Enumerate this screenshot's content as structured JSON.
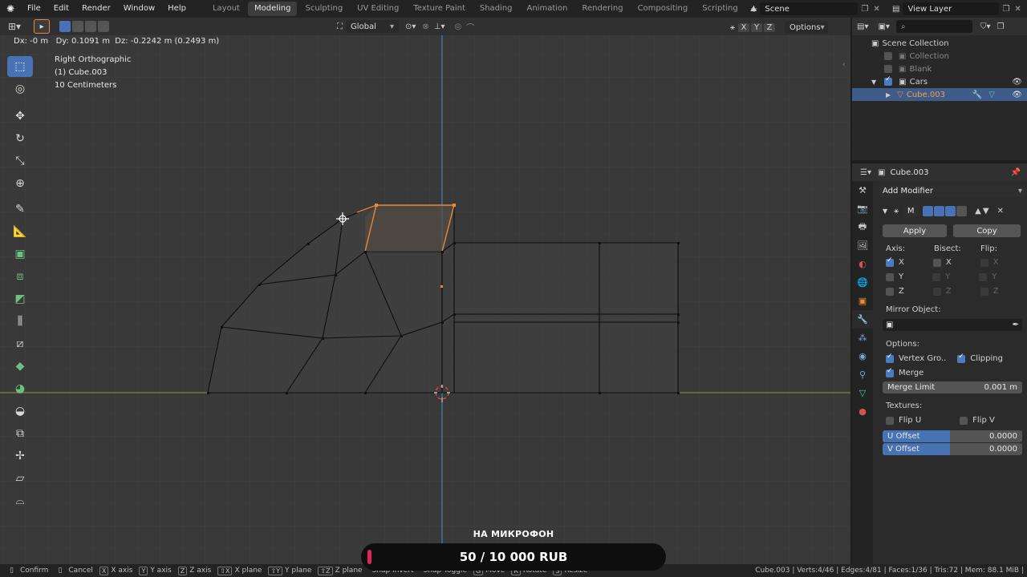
{
  "topbar": {
    "menus": [
      "File",
      "Edit",
      "Render",
      "Window",
      "Help"
    ],
    "workspaces": [
      "Layout",
      "Modeling",
      "Sculpting",
      "UV Editing",
      "Texture Paint",
      "Shading",
      "Animation",
      "Rendering",
      "Compositing",
      "Scripting"
    ],
    "active_workspace": "Modeling",
    "scene": "Scene",
    "view_layer": "View Layer"
  },
  "viewport": {
    "transform_readout": "Dx: -0 m   Dy: 0.1091 m  Dz: -0.2242 m (0.2493 m)",
    "orientation": "Global",
    "view_name": "Right Orthographic",
    "object_label": "(1) Cube.003",
    "scale_label": "10 Centimeters",
    "axis_toggles": [
      "X",
      "Y",
      "Z"
    ],
    "options_label": "Options"
  },
  "outliner": {
    "items": [
      {
        "label": "Scene Collection",
        "checked": false
      },
      {
        "label": "Collection",
        "checked": false
      },
      {
        "label": "Blank",
        "checked": false
      },
      {
        "label": "Cars",
        "checked": true
      },
      {
        "label": "Cube.003",
        "checked": false
      }
    ]
  },
  "properties": {
    "object_name": "Cube.003",
    "add_modifier": "Add Modifier",
    "modifier_letter": "M",
    "apply": "Apply",
    "copy": "Copy",
    "axis_label": "Axis:",
    "bisect_label": "Bisect:",
    "flip_label": "Flip:",
    "axes": [
      "X",
      "Y",
      "Z"
    ],
    "mirror_object_label": "Mirror Object:",
    "options_label": "Options:",
    "vertex_groups": "Vertex Gro..",
    "clipping": "Clipping",
    "merge": "Merge",
    "merge_limit_label": "Merge Limit",
    "merge_limit_value": "0.001 m",
    "textures_label": "Textures:",
    "flip_u": "Flip U",
    "flip_v": "Flip V",
    "u_offset_label": "U Offset",
    "u_offset_value": "0.0000",
    "v_offset_label": "V Offset",
    "v_offset_value": "0.0000"
  },
  "statusbar": {
    "items": [
      {
        "key": "",
        "label": "Confirm"
      },
      {
        "key": "",
        "label": "Cancel"
      },
      {
        "key": "X",
        "label": "X axis"
      },
      {
        "key": "Y",
        "label": "Y axis"
      },
      {
        "key": "Z",
        "label": "Z axis"
      },
      {
        "key": "⇧X",
        "label": "X plane"
      },
      {
        "key": "⇧Y",
        "label": "Y plane"
      },
      {
        "key": "⇧Z",
        "label": "Z plane"
      },
      {
        "key": "",
        "label": "Snap Invert"
      },
      {
        "key": "",
        "label": "Snap Toggle"
      },
      {
        "key": "G",
        "label": "Move"
      },
      {
        "key": "R",
        "label": "Rotate"
      },
      {
        "key": "S",
        "label": "Resize"
      }
    ],
    "stats": "Cube.003 | Verts:4/46 | Edges:4/81 | Faces:1/36 | Tris:72 | Mem: 88.1 MiB |"
  },
  "overlay": {
    "label": "НА МИКРОФОН",
    "amount": "50 / 10 000 RUB",
    "progress": 0.005
  },
  "colors": {
    "accent": "#4772b3",
    "selected_edge": "#e8893a",
    "y_axis": "#4a8ac8",
    "x_axis": "#8a9a3a"
  }
}
